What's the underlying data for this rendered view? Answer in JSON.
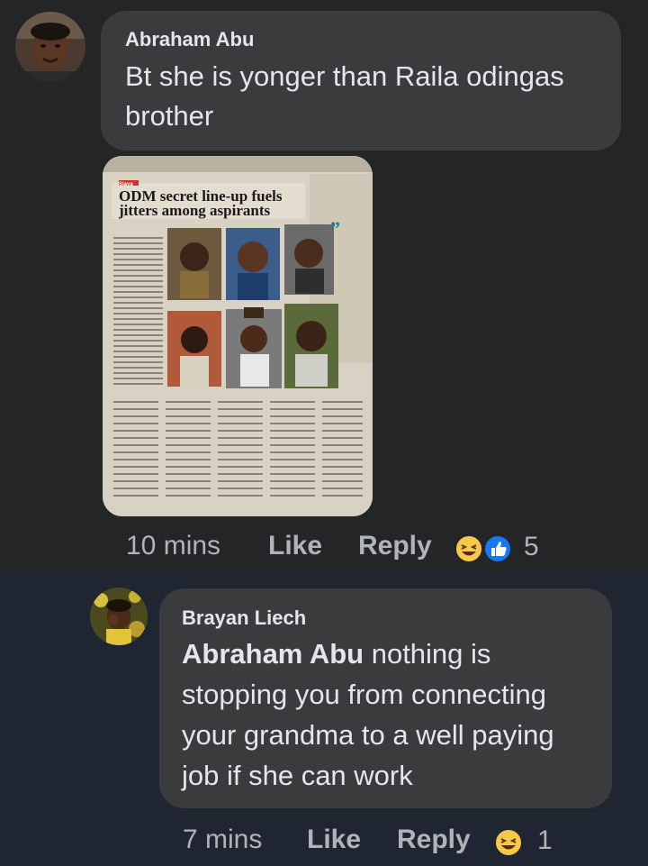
{
  "comment1": {
    "author": "Abraham Abu",
    "text_line1": "Bt she is yonger than Raila odingas",
    "text_line2": "brother",
    "time": "10 mins",
    "like_label": "Like",
    "reply_label": "Reply",
    "reaction_count": "5",
    "reactions": [
      "laughing-emoji-icon",
      "like-thumb-icon"
    ]
  },
  "newspaper": {
    "headline_line1": "ODM secret line-up fuels",
    "headline_line2": "jitters among aspirants",
    "kicker": "Siaya"
  },
  "reply1": {
    "author": "Brayan Liech",
    "mention": "Abraham Abu",
    "text_line1_rest": " nothing is",
    "text_line2": "stopping you from connecting",
    "text_line3": "your grandma to a well paying",
    "text_line4": "job if she can work",
    "time": "7 mins",
    "like_label": "Like",
    "reply_label": "Reply",
    "reaction_count": "1",
    "reactions": [
      "laughing-emoji-icon"
    ]
  },
  "colors": {
    "background": "#242526",
    "reply_background": "#1f2632",
    "bubble": "#3a3b3c",
    "text": "#e4e6eb",
    "meta": "#b0b3b8",
    "like_blue": "#1877f2",
    "haha_yellow": "#f7c84a"
  }
}
